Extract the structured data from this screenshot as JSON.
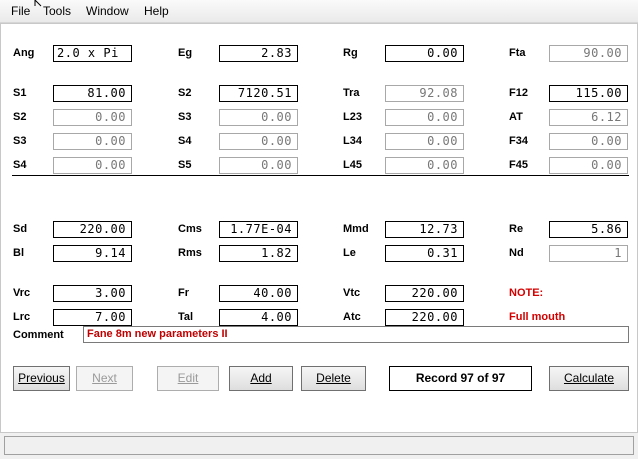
{
  "menu": [
    "File",
    "Tools",
    "Window",
    "Help"
  ],
  "labels": {
    "ang": "Ang",
    "eg": "Eg",
    "rg": "Rg",
    "fta": "Fta",
    "s1": "S1",
    "s2a": "S2",
    "tra": "Tra",
    "f12": "F12",
    "s2": "S2",
    "s3a": "S3",
    "l23": "L23",
    "at": "AT",
    "s3": "S3",
    "s4a": "S4",
    "l34": "L34",
    "f34": "F34",
    "s4": "S4",
    "s5": "S5",
    "l45": "L45",
    "f45": "F45",
    "sd": "Sd",
    "cms": "Cms",
    "mmd": "Mmd",
    "re": "Re",
    "bl": "Bl",
    "rms": "Rms",
    "le": "Le",
    "nd": "Nd",
    "vrc": "Vrc",
    "fr": "Fr",
    "vtc": "Vtc",
    "note": "NOTE:",
    "lrc": "Lrc",
    "tal": "Tal",
    "atc": "Atc",
    "note_text": "Full mouth",
    "comment": "Comment"
  },
  "values": {
    "ang": "2.0 x Pi",
    "eg": "2.83",
    "rg": "0.00",
    "fta": "90.00",
    "s1": "81.00",
    "s2a": "7120.51",
    "tra": "92.08",
    "f12": "115.00",
    "s2": "0.00",
    "s3a": "0.00",
    "l23": "0.00",
    "at": "6.12",
    "s3": "0.00",
    "s4a": "0.00",
    "l34": "0.00",
    "f34": "0.00",
    "s4": "0.00",
    "s5": "0.00",
    "l45": "0.00",
    "f45": "0.00",
    "sd": "220.00",
    "cms": "1.77E-04",
    "mmd": "12.73",
    "re": "5.86",
    "bl": "9.14",
    "rms": "1.82",
    "le": "0.31",
    "nd": "1",
    "vrc": "3.00",
    "fr": "40.00",
    "vtc": "220.00",
    "lrc": "7.00",
    "tal": "4.00",
    "atc": "220.00"
  },
  "comment_value": "Fane 8m new parameters II",
  "buttons": {
    "previous": "Previous",
    "next": "Next",
    "edit": "Edit",
    "add": "Add",
    "delete": "Delete",
    "calculate": "Calculate"
  },
  "record": "Record 97 of 97",
  "colors": {
    "note": "#d40000",
    "comment_text": "#c00000"
  }
}
